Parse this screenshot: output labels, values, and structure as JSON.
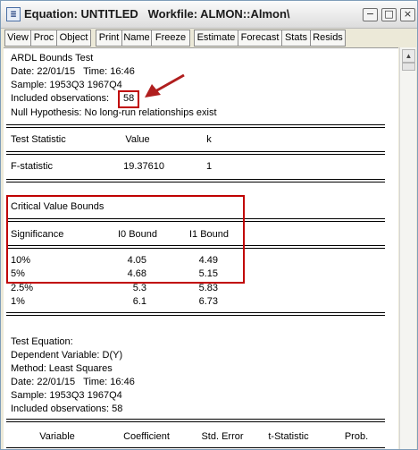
{
  "window": {
    "title": "Equation: UNTITLED   Workfile: ALMON::Almon\\",
    "app_icon": "eq-icon",
    "buttons": {
      "minimize": "−",
      "maximize": "□",
      "close": "×"
    }
  },
  "toolbar": {
    "items": [
      "View",
      "Proc",
      "Object",
      "Print",
      "Name",
      "Freeze",
      "Estimate",
      "Forecast",
      "Stats",
      "Resids"
    ]
  },
  "output": {
    "header": {
      "title": "ARDL Bounds Test",
      "date": "Date: 22/01/15   Time: 16:46",
      "sample": "Sample: 1953Q3 1967Q4",
      "included_label": "Included observations:",
      "included_value": "58",
      "null_hypothesis": "Null Hypothesis: No long-run relationships exist"
    },
    "stat_table": {
      "headers": [
        "Test Statistic",
        "Value",
        "k"
      ],
      "rows": [
        [
          "F-statistic",
          "19.37610",
          "1"
        ]
      ]
    },
    "bounds": {
      "title": "Critical Value Bounds",
      "headers": [
        "Significance",
        "I0 Bound",
        "I1 Bound"
      ],
      "rows": [
        [
          "10%",
          "4.05",
          "4.49"
        ],
        [
          "5%",
          "4.68",
          "5.15"
        ],
        [
          "2.5%",
          "5.3",
          "5.83"
        ],
        [
          "1%",
          "6.1",
          "6.73"
        ]
      ]
    },
    "test_equation": {
      "title": "Test Equation:",
      "dependent": "Dependent Variable: D(Y)",
      "method": "Method: Least Squares",
      "date": "Date: 22/01/15   Time: 16:46",
      "sample": "Sample: 1953Q3 1967Q4",
      "included": "Included observations: 58"
    },
    "coef_headers": [
      "Variable",
      "Coefficient",
      "Std. Error",
      "t-Statistic",
      "Prob."
    ]
  },
  "colors": {
    "annotation_red": "#c00000",
    "arrow_red": "#b01e1e"
  }
}
